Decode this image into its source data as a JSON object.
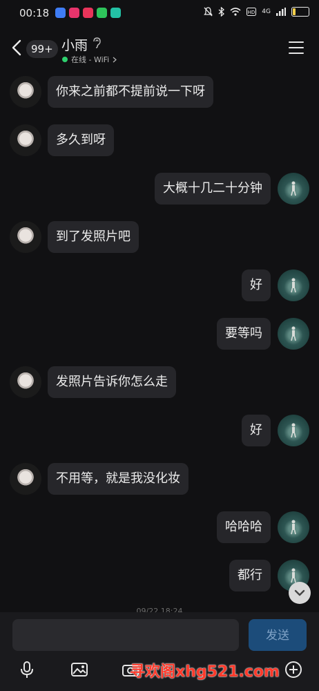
{
  "status_bar": {
    "time": "00:18",
    "network": "4G",
    "battery": "20",
    "battery_level": 0.2
  },
  "header": {
    "unread_badge": "99+",
    "title": "小雨",
    "online_status": "在线 - WiFi"
  },
  "messages": [
    {
      "side": "left",
      "text": "你来之前都不提前说一下呀"
    },
    {
      "side": "left",
      "text": "多久到呀"
    },
    {
      "side": "right",
      "text": "大概十几二十分钟"
    },
    {
      "side": "left",
      "text": "到了发照片吧"
    },
    {
      "side": "right",
      "text": "好"
    },
    {
      "side": "right",
      "text": "要等吗"
    },
    {
      "side": "left",
      "text": "发照片告诉你怎么走"
    },
    {
      "side": "right",
      "text": "好"
    },
    {
      "side": "left",
      "text": "不用等，就是我没化妆"
    },
    {
      "side": "right",
      "text": "哈哈哈"
    },
    {
      "side": "right",
      "text": "都行"
    }
  ],
  "timestamp": "09/22 18:24",
  "input": {
    "placeholder": "",
    "send_label": "发送"
  },
  "watermark": "寻欢阁xhg521.com",
  "colors": {
    "background": "#111113",
    "bubble": "#26262a",
    "online": "#2ed06e",
    "send_button": "#1c4c7a"
  },
  "icons": [
    "back-arrow-icon",
    "ear-icon",
    "menu-icon",
    "microphone-icon",
    "image-icon",
    "camera-icon",
    "plus-icon",
    "chevron-down-icon"
  ]
}
